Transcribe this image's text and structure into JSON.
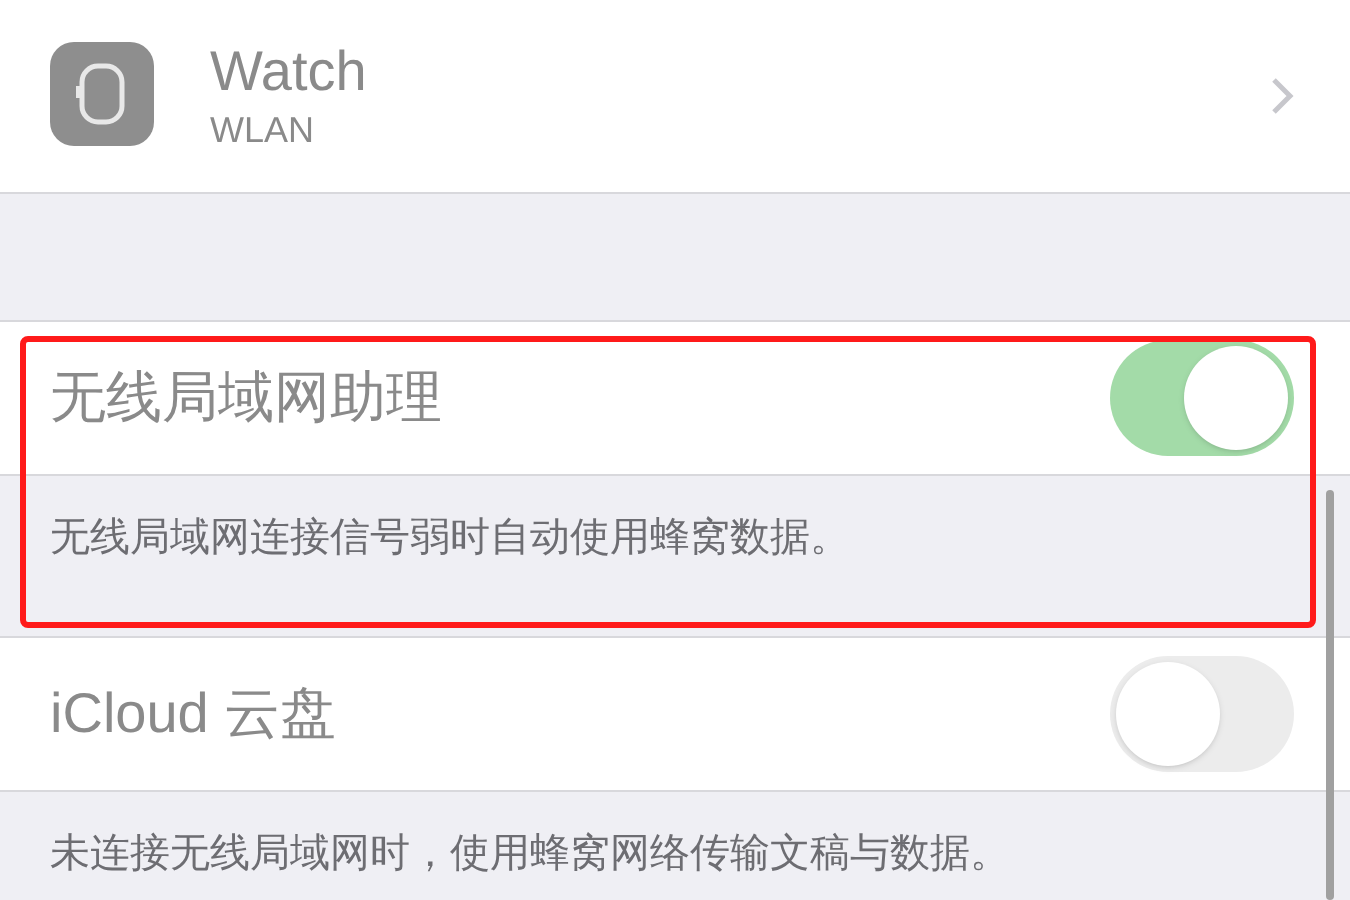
{
  "device_row": {
    "title": "Watch",
    "subtitle": "WLAN"
  },
  "settings": [
    {
      "label": "无线局域网助理",
      "on": true,
      "footer": "无线局域网连接信号弱时自动使用蜂窝数据。",
      "highlighted": true
    },
    {
      "label": "iCloud 云盘",
      "on": false,
      "footer": "未连接无线局域网时，使用蜂窝网络传输文稿与数据。",
      "highlighted": false
    }
  ]
}
